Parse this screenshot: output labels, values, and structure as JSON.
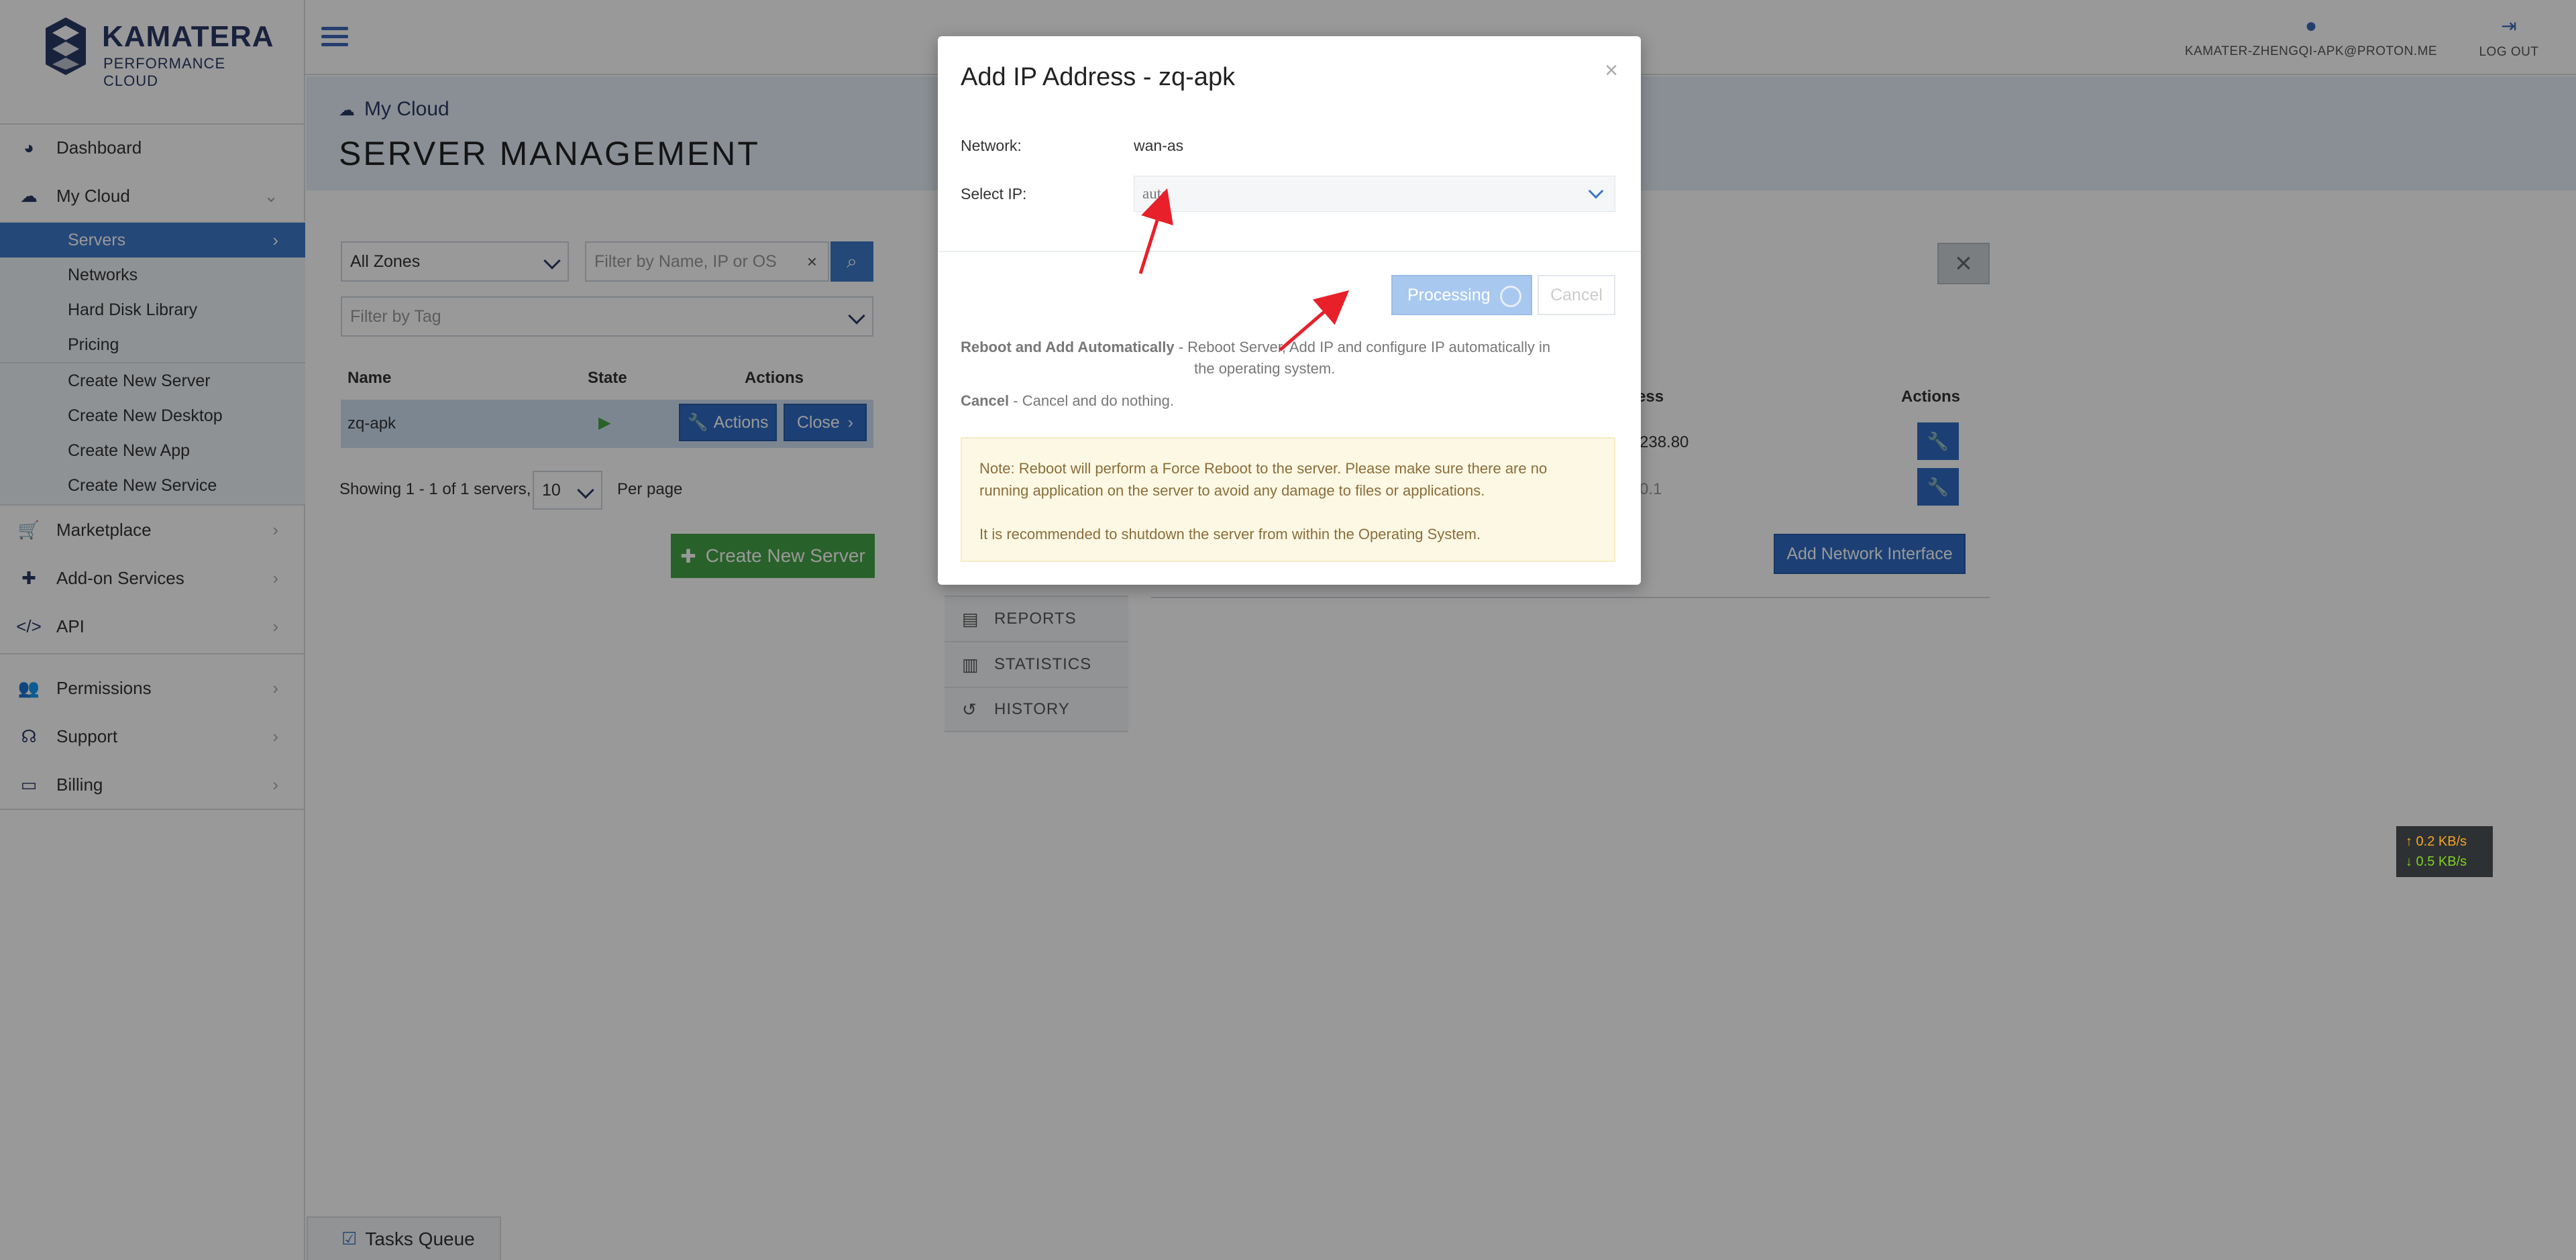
{
  "brand": {
    "name": "KAMATERA",
    "tagline": "PERFORMANCE CLOUD"
  },
  "sidebar": {
    "items": [
      {
        "id": "dashboard",
        "label": "Dashboard",
        "icon": "dashboard-icon"
      },
      {
        "id": "mycloud",
        "label": "My Cloud",
        "icon": "cloud-icon"
      },
      {
        "id": "marketplace",
        "label": "Marketplace",
        "icon": "cart-icon"
      },
      {
        "id": "addons",
        "label": "Add-on Services",
        "icon": "puzzle-icon"
      },
      {
        "id": "api",
        "label": "API",
        "icon": "code-icon"
      },
      {
        "id": "permissions",
        "label": "Permissions",
        "icon": "users-icon"
      },
      {
        "id": "support",
        "label": "Support",
        "icon": "headset-icon"
      },
      {
        "id": "billing",
        "label": "Billing",
        "icon": "credit-card-icon"
      }
    ],
    "mycloud_sub": [
      "Servers",
      "Networks",
      "Hard Disk Library",
      "Pricing"
    ],
    "create_sub": [
      "Create New Server",
      "Create New Desktop",
      "Create New App",
      "Create New Service"
    ]
  },
  "header": {
    "user_email": "KAMATER-ZHENGQI-APK@PROTON.ME",
    "logout": "LOG OUT"
  },
  "page": {
    "breadcrumb": "My Cloud",
    "title": "SERVER MANAGEMENT"
  },
  "servers": {
    "zone_select": "All Zones",
    "filter_placeholder": "Filter by Name, IP or OS",
    "tag_placeholder": "Filter by Tag",
    "columns": [
      "Name",
      "State",
      "Actions"
    ],
    "rows": [
      {
        "name": "zq-apk",
        "state": "▶",
        "actions_label": "Actions",
        "close_label": "Close"
      }
    ],
    "showing": "Showing 1 - 1 of 1 servers,",
    "per_page_value": "10",
    "per_page_label": "Per page",
    "create_button": "Create New Server"
  },
  "details": {
    "tabs": [
      "REPORTS",
      "STATISTICS",
      "HISTORY"
    ],
    "columns": [
      "ess",
      "Actions"
    ],
    "rows": [
      "238.80",
      "0.1"
    ],
    "add_interface": "Add Network Interface"
  },
  "modal": {
    "title": "Add IP Address - zq-apk",
    "network_label": "Network:",
    "network_value": "wan-as",
    "select_ip_label": "Select IP:",
    "select_ip_value": "auto",
    "processing_label": "Processing",
    "cancel_label": "Cancel",
    "reboot_title": "Reboot and Add Automatically",
    "reboot_desc": "- Reboot Server, Add IP and configure IP automatically in",
    "reboot_desc2": "the operating system.",
    "cancel_title": "Cancel",
    "cancel_desc": "- Cancel and do nothing.",
    "note_line1": "Note: Reboot will perform a Force Reboot to the server. Please make sure there are no running application on the server to avoid any damage to files or applications.",
    "note_line2": "It is recommended to shutdown the server from within the Operating System."
  },
  "tasks": {
    "label": "Tasks Queue"
  },
  "network_widget": {
    "up": "↑ 0.2 KB/s",
    "down": "↓ 0.5 KB/s"
  },
  "colors": {
    "primary": "#2f6bc4",
    "success": "#45a246",
    "brand": "#2b3a67"
  }
}
